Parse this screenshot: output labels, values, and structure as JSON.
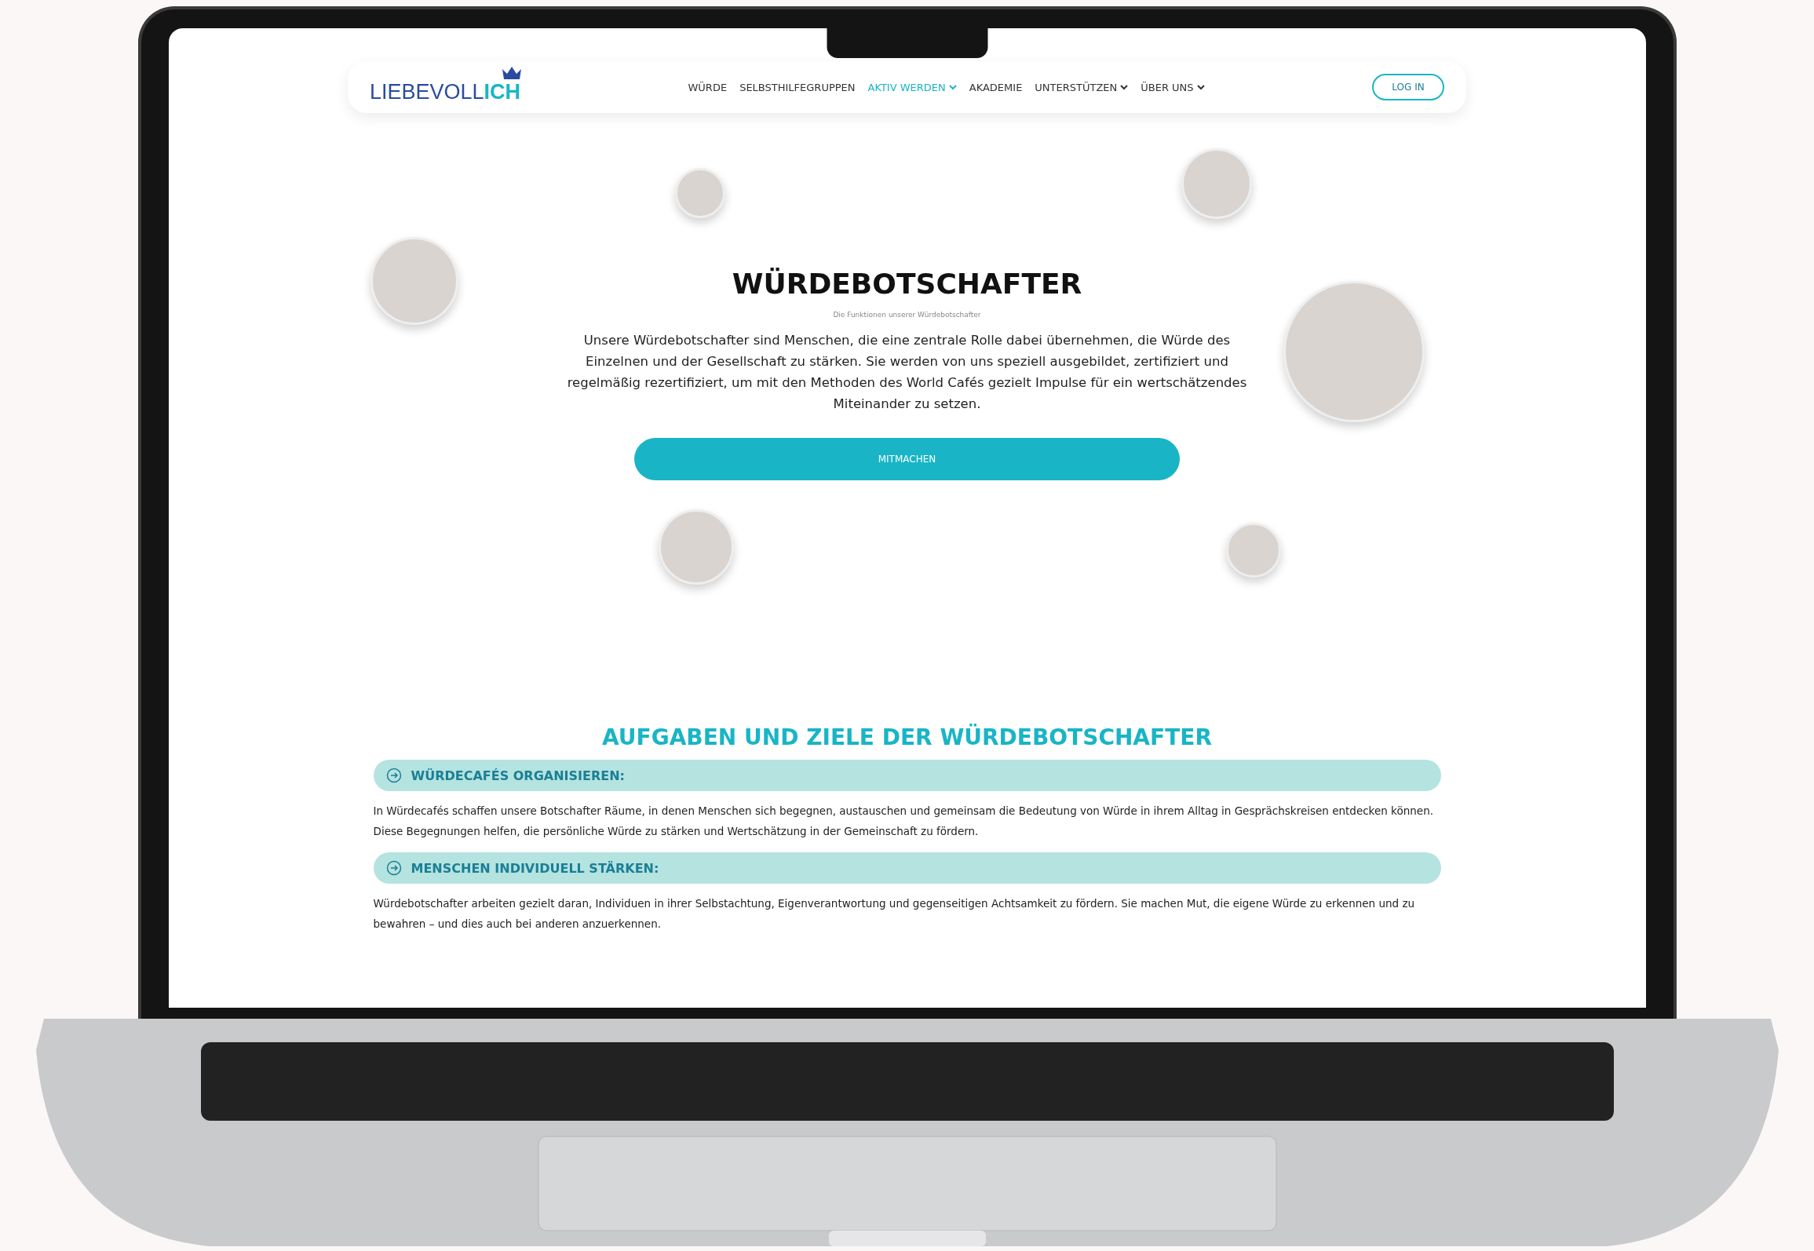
{
  "nav": {
    "logo": {
      "main": "LIEBEVOLL",
      "accent": "ICH"
    },
    "items": [
      {
        "label": "WÜRDE",
        "selected": false,
        "dropdown": false
      },
      {
        "label": "SELBSTHILFEGRUPPEN",
        "selected": false,
        "dropdown": false
      },
      {
        "label": "AKTIV WERDEN",
        "selected": true,
        "dropdown": true
      },
      {
        "label": "AKADEMIE",
        "selected": false,
        "dropdown": false
      },
      {
        "label": "UNTERSTÜTZEN",
        "selected": false,
        "dropdown": true
      },
      {
        "label": "ÜBER UNS",
        "selected": false,
        "dropdown": true
      }
    ],
    "login": "LOG IN"
  },
  "hero": {
    "title": "WÜRDEBOTSCHAFTER",
    "subtitle": "Die Funktionen unserer Würdebotschafter",
    "text": "Unsere Würdebotschafter sind Menschen, die eine zentrale Rolle dabei übernehmen, die Würde des Einzelnen und der Gesellschaft zu stärken. Sie werden von uns speziell ausgebildet, zertifiziert und regelmäßig rezertifiziert, um mit den Methoden des World Cafés gezielt Impulse für ein wertschätzendes Miteinander zu setzen.",
    "button": "MITMACHEN"
  },
  "section": {
    "heading": "AUFGABEN UND ZIELE DER WÜRDEBOTSCHAFTER",
    "items": [
      {
        "title": "WÜRDECAFÉS ORGANISIEREN:",
        "text": "In Würdecafés schaffen unsere Botschafter Räume, in denen Menschen sich begegnen, austauschen und gemeinsam die Bedeutung von Würde in ihrem Alltag in Gesprächskreisen entdecken können. Diese Begegnungen helfen, die persönliche Würde zu stärken und Wertschätzung in der Gemeinschaft zu fördern."
      },
      {
        "title": "MENSCHEN INDIVIDUELL STÄRKEN:",
        "text": "Würdebotschafter arbeiten gezielt daran, Individuen in ihrer Selbstachtung, Eigenverantwortung und gegenseitigen Achtsamkeit zu fördern. Sie machen Mut, die eigene Würde zu erkennen und zu bewahren – und dies auch bei anderen anzuerkennen."
      }
    ]
  }
}
